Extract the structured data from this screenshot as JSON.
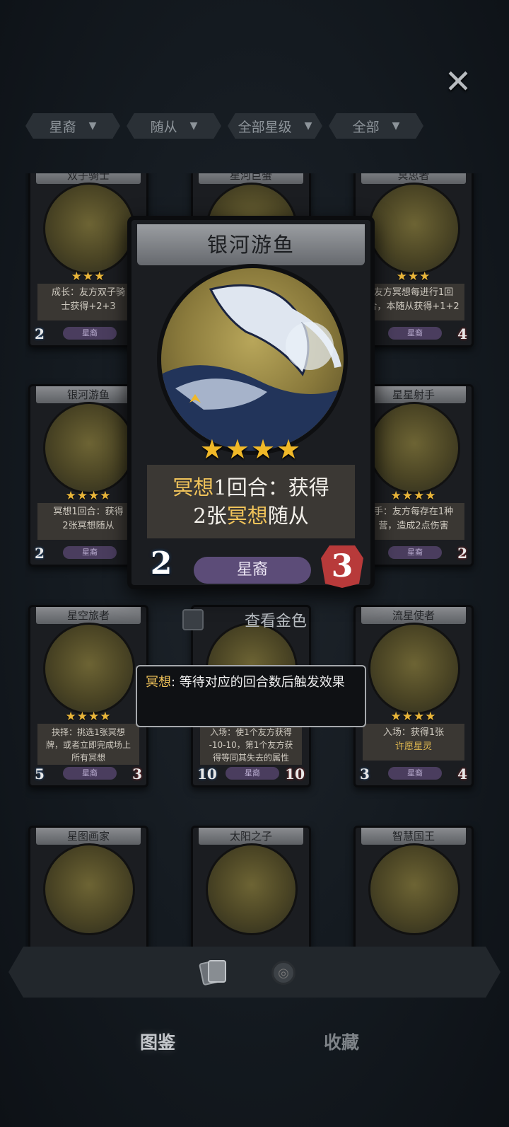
{
  "close_icon": "✕",
  "filters": [
    {
      "label": "星裔",
      "icon": "funnel-icon"
    },
    {
      "label": "随从",
      "icon": "funnel-icon"
    },
    {
      "label": "全部星级",
      "icon": "funnel-icon"
    },
    {
      "label": "全部",
      "icon": "funnel-icon"
    }
  ],
  "cards": [
    {
      "name": "双子骑士",
      "stars": "★★★",
      "desc": [
        "成长：友方双子骑",
        "士获得+2+3"
      ],
      "keyword": "成长",
      "tribe": "星裔",
      "cost": "2",
      "attack": ""
    },
    {
      "name": "星河巨蟹",
      "stars": "",
      "desc": [
        "",
        ""
      ],
      "tribe": "",
      "cost": "",
      "attack": ""
    },
    {
      "name": "冥思者",
      "stars": "★★★",
      "desc": [
        "友方冥想每进行1回",
        "合，本随从获得+1+2"
      ],
      "keyword": "冥想",
      "tribe": "星裔",
      "cost": "",
      "attack": "4"
    },
    {
      "name": "银河游鱼",
      "stars": "★★★★",
      "desc": [
        "冥想1回合：获得",
        "2张冥想随从"
      ],
      "keyword": "冥想",
      "tribe": "星裔",
      "cost": "2",
      "attack": ""
    },
    {
      "name": "星星射手",
      "stars": "★★★★",
      "desc": [
        "手：友方每存在1种",
        "营，造成2点伤害"
      ],
      "tribe": "星裔",
      "cost": "",
      "attack": "2"
    },
    {
      "name": "星空旅者",
      "stars": "★★★★",
      "desc": [
        "抉择：挑选1张冥想",
        "牌，或者立即完成场上",
        "所有冥想"
      ],
      "keyword": "抉择",
      "tribe": "星裔",
      "cost": "5",
      "attack": "3"
    },
    {
      "name": "",
      "stars": "",
      "desc": [
        "入场：使1个友方获得",
        "-10-10，第1个友方获",
        "得等同其失去的属性"
      ],
      "keyword": "入场",
      "tribe": "星裔",
      "cost": "10",
      "attack": "10"
    },
    {
      "name": "流星使者",
      "stars": "★★★★",
      "desc": [
        "入场：获得1张",
        "许愿星灵"
      ],
      "keyword": "入场",
      "tribe": "星裔",
      "cost": "3",
      "attack": "4"
    },
    {
      "name": "星图画家",
      "stars": "",
      "desc": [
        "",
        ""
      ],
      "tribe": "",
      "cost": "",
      "attack": ""
    },
    {
      "name": "太阳之子",
      "stars": "",
      "desc": [
        "",
        ""
      ],
      "tribe": "",
      "cost": "",
      "attack": ""
    },
    {
      "name": "智慧国王",
      "stars": "",
      "desc": [
        "",
        ""
      ],
      "tribe": "",
      "cost": "",
      "attack": ""
    }
  ],
  "selected_card": {
    "name": "银河游鱼",
    "stars": "★★★★",
    "desc_line1_kw": "冥想",
    "desc_line1_rest": "1回合：获得",
    "desc_line2_pre": "2张",
    "desc_line2_kw": "冥想",
    "desc_line2_post": "随从",
    "tribe": "星裔",
    "cost": "2",
    "attack": "3"
  },
  "gold_toggle": {
    "label": "查看金色",
    "checked": false
  },
  "tooltip": {
    "keyword": "冥想",
    "text": ": 等待对应的回合数后触发效果"
  },
  "bottom_tabs": [
    {
      "label": "图鉴",
      "active": true
    },
    {
      "label": "收藏",
      "active": false
    }
  ],
  "colors": {
    "keyword": "#f0c35a",
    "tribe_pill": "#5c4c78",
    "cost_gem": "#3c6fa5",
    "attack_gem": "#b83a3a"
  }
}
